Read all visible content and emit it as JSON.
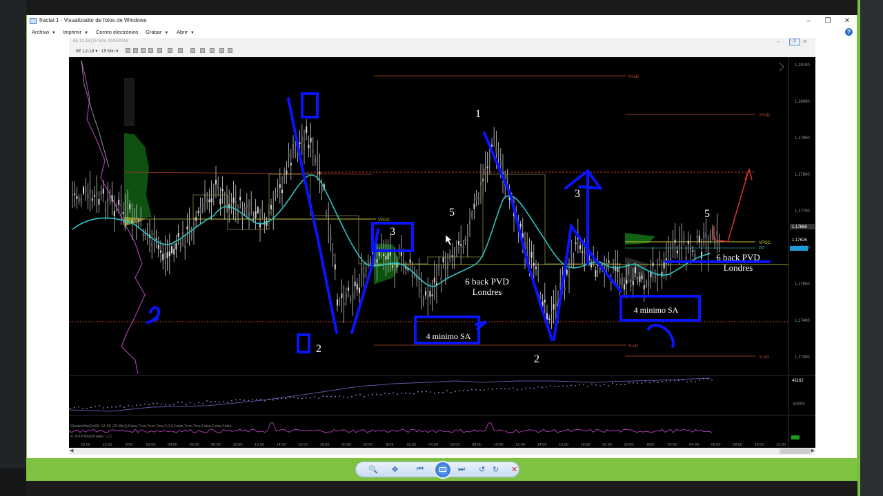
{
  "window": {
    "title": "fractal 1 - Visualizador de fotos de Windows",
    "minimize": "–",
    "restore": "❐",
    "close": "✕"
  },
  "menu": {
    "items": [
      "Archivo",
      "Imprimir",
      "Correo electrónico",
      "Grabar",
      "Abrir"
    ],
    "help": "?"
  },
  "picture_toolbar": {
    "caption": "6E 12-18 (15 Min) 20/08/2018",
    "instrument": "6E 12-18",
    "interval": "15 Min",
    "mini_button": "1",
    "ctrl_min": "–",
    "ctrl_max": "□",
    "ctrl_close": "✕"
  },
  "chart": {
    "price_labels": [
      "1,18100",
      "1,18000",
      "1,17900",
      "1,17800",
      "1,17700",
      "1,17600",
      "1,17500",
      "1,17400",
      "1,17300"
    ],
    "current_prices": [
      "1,17666",
      "1,17626"
    ],
    "level_tags": [
      "YHoD",
      "YHoD",
      "VPOC",
      "VPOC",
      "PP",
      "YLoD",
      "YLoD"
    ],
    "indicator_value": "43162",
    "indicator_value_2": "-50000",
    "indicator_caption": "ClusterMaxEx(6E 12-18 (15 Min)),Falso,True,True,True,0,0,0,False,True,True,False,False,False",
    "copyright": "© 2018 NinjaTrader, LLC",
    "time_labels": [
      "20:00",
      "22:00",
      "8/16",
      "02:00",
      "04:00",
      "06:00",
      "08:00",
      "10:00",
      "12:00",
      "14:00",
      "16:00",
      "18:00",
      "20:00",
      "22:00",
      "8/19",
      "02:00",
      "04:00",
      "06:00",
      "08:00",
      "10:00",
      "12:00",
      "14:00",
      "16:00",
      "18:00",
      "20:00",
      "22:00",
      "8/20",
      "02:00",
      "04:00",
      "06:00",
      "08:00",
      "10:00",
      "12:00"
    ],
    "annotations": {
      "n1": "1",
      "n2a": "2",
      "n2b": "2",
      "n3a": "3",
      "n3b": "3",
      "n5a": "5",
      "n5b": "5",
      "pvd_line1": "6 back PVD",
      "pvd_line2": "Londres",
      "pvd2_line1": "6 back PVD",
      "pvd2_line2": "Londres",
      "min_sa_1": "4 minimo SA",
      "min_sa_2": "4 minimo SA"
    },
    "colors": {
      "annotation": "#0a14ff",
      "ema": "#2ec4c4",
      "level_red": "#c0392b",
      "profile_green": "#1f8a1f",
      "volume_purple": "#b03ab0"
    }
  },
  "nav": {
    "zoom_icon": "🔍",
    "fit_icon": "✥",
    "prev_icon": "⏮",
    "next_icon": "⏭",
    "rotate_ccw_icon": "↺",
    "rotate_cw_icon": "↻",
    "delete_icon": "✕"
  }
}
